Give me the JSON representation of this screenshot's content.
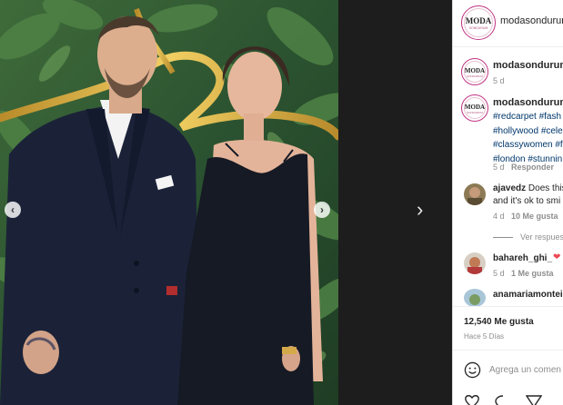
{
  "post": {
    "account": "modasondurum",
    "avatar_logo_top": "MODA",
    "avatar_logo_sub": "SONDURUM"
  },
  "caption_owner_row": {
    "username": "modasondurum",
    "age": "5 d"
  },
  "caption": {
    "username": "modasondurum",
    "hashtag_lines": [
      "#redcarpet #fash",
      "#hollywood #cele",
      "#classywomen #f",
      "#london #stunnin"
    ],
    "age": "5 d",
    "reply_label": "Responder"
  },
  "comments": [
    {
      "username": "ajavedz",
      "text_line1": "Does this",
      "text_line2": "and it's ok to smi",
      "age": "4 d",
      "likes": "10 Me gusta",
      "replies_label": "Ver respues"
    },
    {
      "username": "bahareh_ghi_",
      "heart": "❤",
      "age": "5 d",
      "likes": "1 Me gusta"
    },
    {
      "username": "anamariamontei"
    }
  ],
  "stats": {
    "likes": "12,540 Me gusta",
    "ago": "Hace 5 Días"
  },
  "composer": {
    "placeholder": "Agrega un comen"
  },
  "navigation": {
    "prev_glyph": "‹",
    "next_glyph": "›",
    "outer_next_glyph": "›"
  },
  "colors": {
    "link_blue": "#00376b",
    "story_ring": "#c13584",
    "heart_red": "#ed4956",
    "backdrop": "#1e1e1e"
  },
  "icons": [
    "chevron-left-icon",
    "chevron-right-icon",
    "smile-icon",
    "heart-outline-icon",
    "comment-icon",
    "share-icon"
  ]
}
